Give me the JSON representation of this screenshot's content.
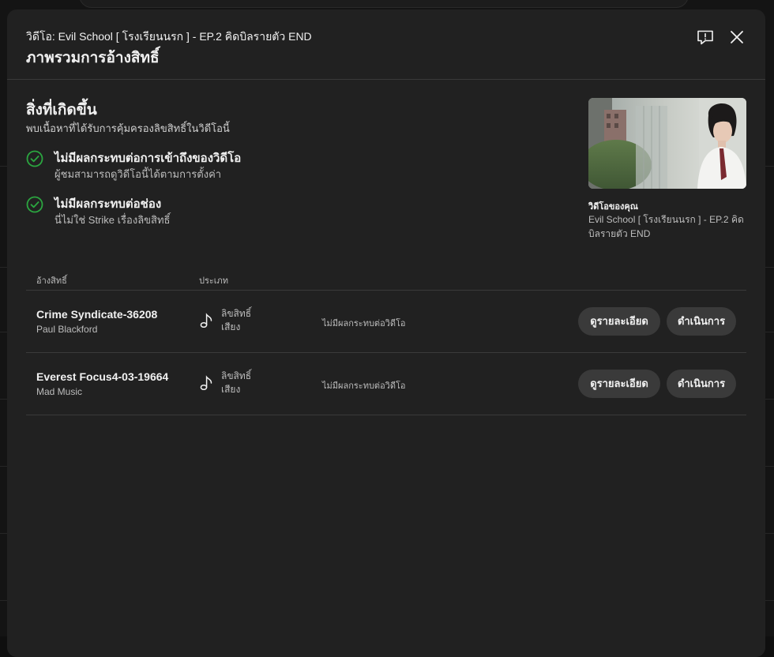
{
  "modal": {
    "video_title": "วิดีโอ: Evil School [ โรงเรียนนรก ] - EP.2 คิดบิลรายตัว END",
    "page_title": "ภาพรวมการอ้างสิทธิ์"
  },
  "summary": {
    "title": "สิ่งที่เกิดขึ้น",
    "subtitle": "พบเนื้อหาที่ได้รับการคุ้มครองลิขสิทธิ์ในวิดีโอนี้",
    "impacts": [
      {
        "title": "ไม่มีผลกระทบต่อการเข้าถึงของวิดีโอ",
        "subtitle": "ผู้ชมสามารถดูวิดีโอนี้ได้ตามการตั้งค่า"
      },
      {
        "title": "ไม่มีผลกระทบต่อช่อง",
        "subtitle": "นี่ไม่ใช่ Strike เรื่องลิขสิทธิ์"
      }
    ]
  },
  "your_video": {
    "label": "วิดีโอของคุณ",
    "title": "Evil School [ โรงเรียนนรก ] - EP.2 คิดบิลรายตัว END"
  },
  "table": {
    "headers": [
      "อ้างสิทธิ์",
      "ประเภท"
    ],
    "rows": [
      {
        "claim": "Crime Syndicate-36208",
        "owner": "Paul Blackford",
        "type_line1": "ลิขสิทธิ์",
        "type_line2": "เสียง",
        "impact": "ไม่มีผลกระทบต่อวิดีโอ",
        "details_label": "ดูรายละเอียด",
        "action_label": "ดำเนินการ"
      },
      {
        "claim": "Everest Focus4-03-19664",
        "owner": "Mad Music",
        "type_line1": "ลิขสิทธิ์",
        "type_line2": "เสียง",
        "impact": "ไม่มีผลกระทบต่อวิดีโอ",
        "details_label": "ดูรายละเอียด",
        "action_label": "ดำเนินการ"
      }
    ]
  },
  "icons": {
    "feedback": "feedback-icon",
    "close": "close-icon",
    "check": "check-circle-icon",
    "music": "music-note-icon"
  },
  "colors": {
    "modal_bg": "#212121",
    "check_green": "#2ba640",
    "button_bg": "#3a3a3a"
  }
}
